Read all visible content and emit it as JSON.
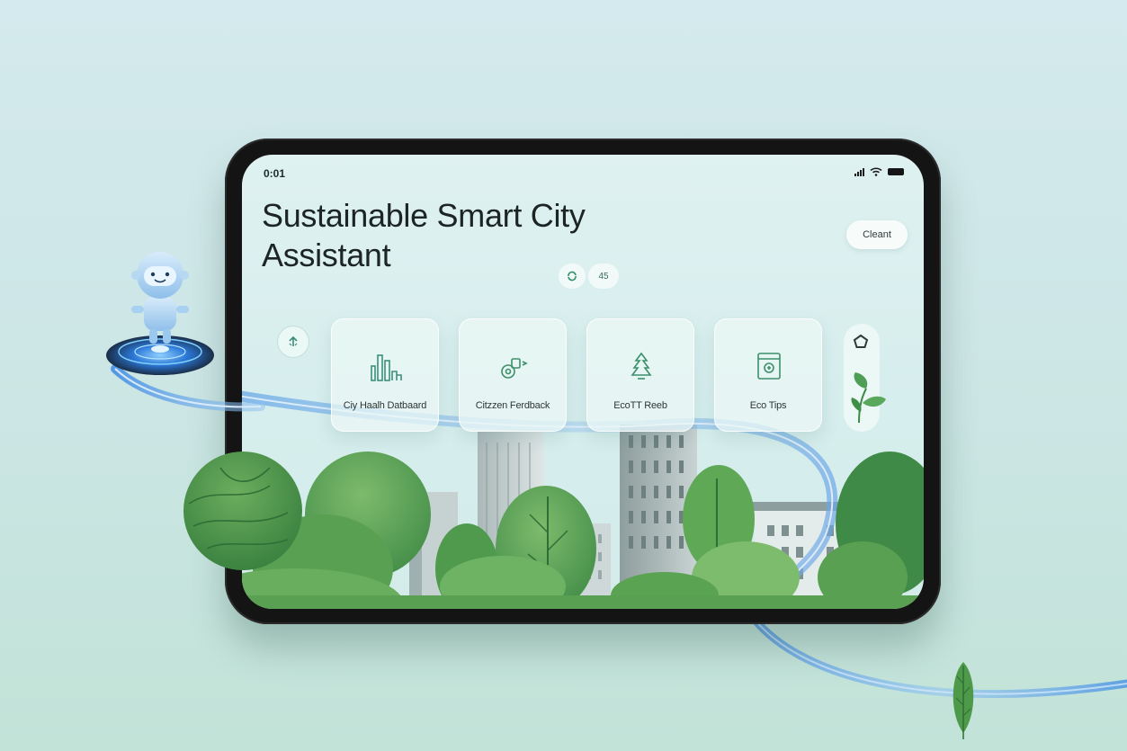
{
  "status_bar": {
    "time": "0:01"
  },
  "header": {
    "title_line1": "Sustainable Smart City",
    "title_line2": "Assistant",
    "clear_label": "Cleant"
  },
  "mini_pills": {
    "second_label": "45"
  },
  "cards": [
    {
      "label": "Ciy Haalh Datbaard",
      "icon": "bar-chart-icon"
    },
    {
      "label": "Citzzen Ferdback",
      "icon": "feedback-icon"
    },
    {
      "label": "EcoTT Reeb",
      "icon": "recycle-icon"
    },
    {
      "label": "Eco Tips",
      "icon": "eco-tips-icon"
    }
  ],
  "colors": {
    "background": "#cfe8e6",
    "tablet_frame": "#141414",
    "screen": "#d8eeed",
    "accent_green": "#4e9e55",
    "accent_blue": "#6aa6e6"
  }
}
